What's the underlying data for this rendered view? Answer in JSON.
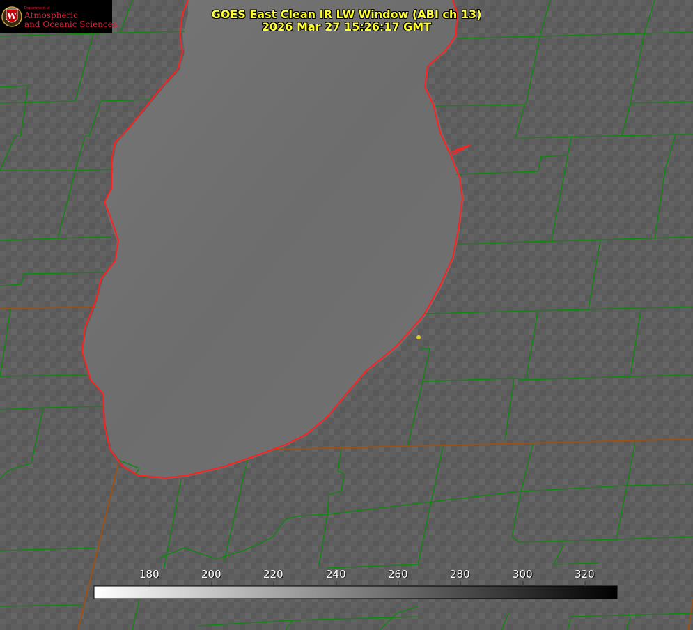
{
  "title": {
    "line1": "GOES East Clean IR LW Window (ABI ch 13)",
    "line2": "2026 Mar 27 15:26:17 GMT"
  },
  "logo": {
    "dept": "Department of",
    "line1": "Atmospheric",
    "line2": "and Oceanic Sciences",
    "shield_letter": "W"
  },
  "colorbar": {
    "ticks": [
      "180",
      "200",
      "220",
      "240",
      "260",
      "280",
      "300",
      "320"
    ],
    "min_color": "#ffffff",
    "max_color": "#000000"
  },
  "colors": {
    "background": "#5e5e5e",
    "lake": "#707070",
    "county_lines": "#0a8a0a",
    "state_lines": "#a05010",
    "coastline": "#ff2020",
    "title": "#ffff33",
    "marker": "#e0d020"
  }
}
